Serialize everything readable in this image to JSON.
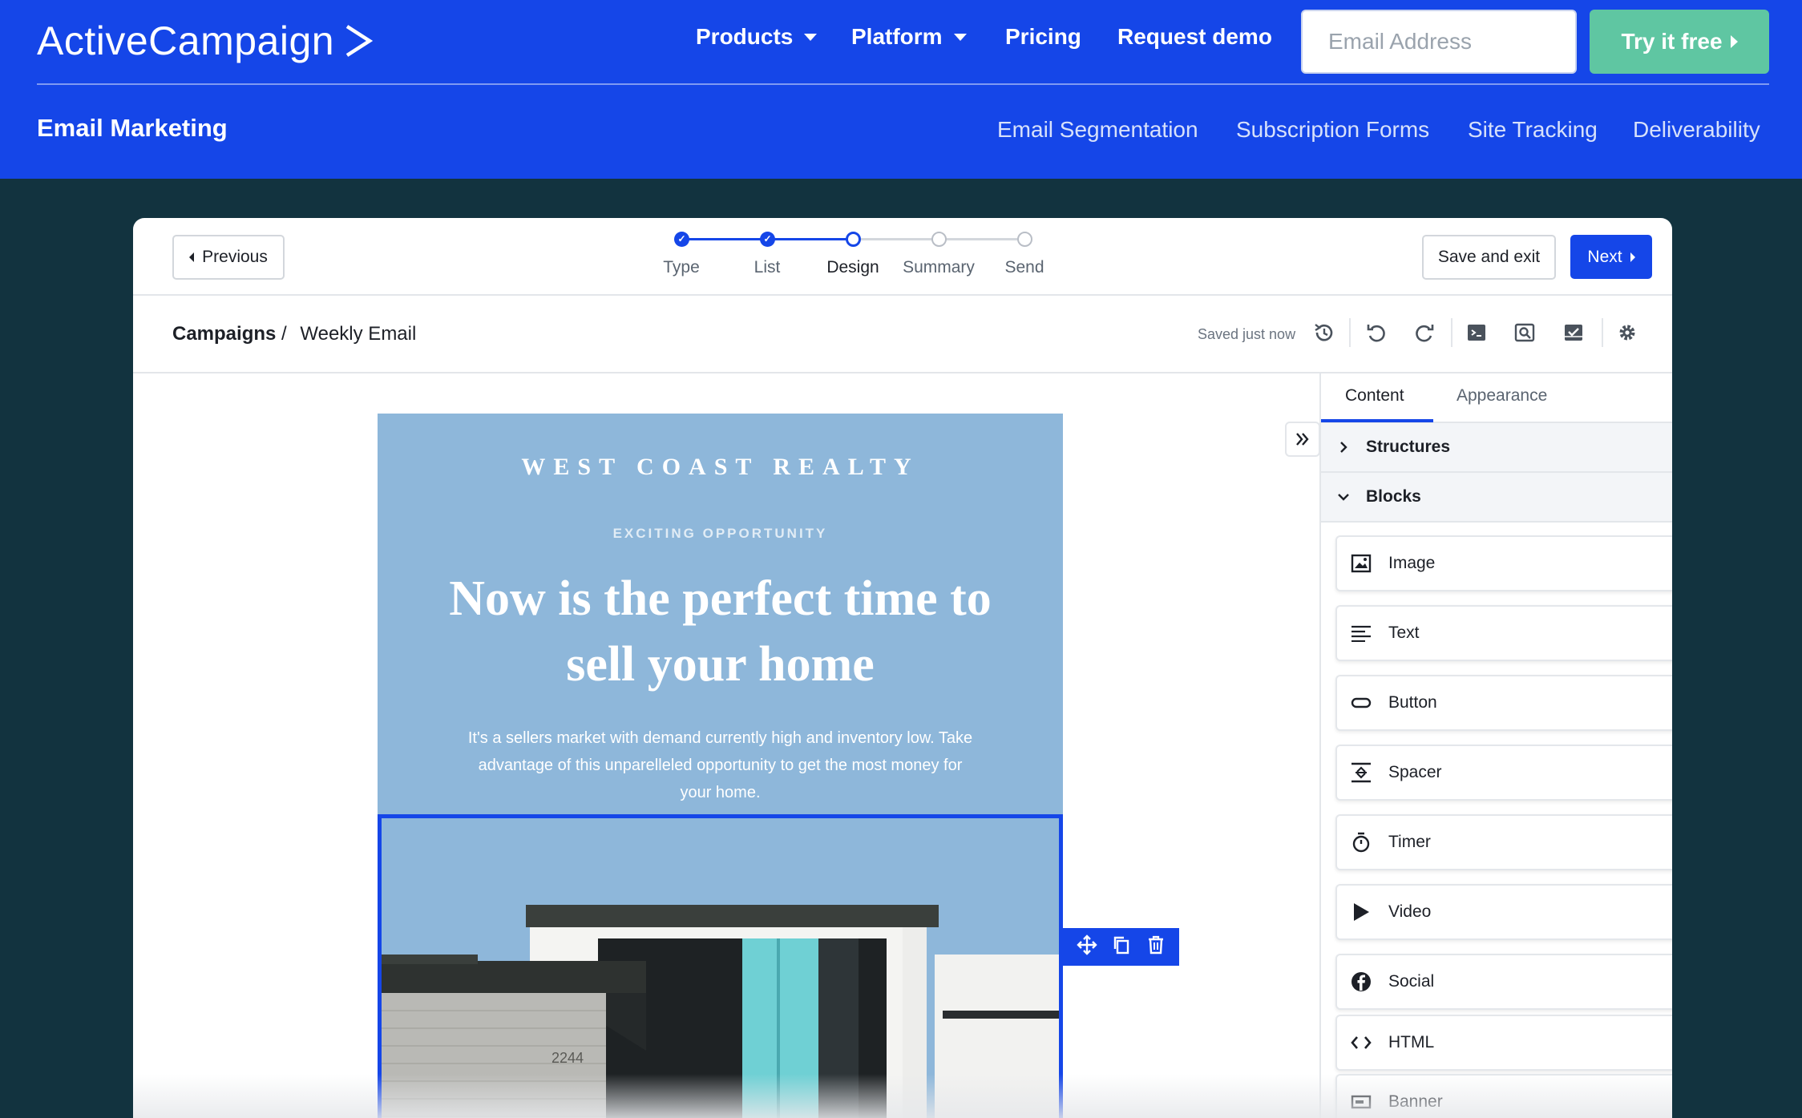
{
  "site": {
    "brand": "ActiveCampaign",
    "nav": [
      "Products",
      "Platform",
      "Pricing",
      "Request demo"
    ],
    "email_placeholder": "Email Address",
    "cta": "Try it free",
    "section_title": "Email Marketing",
    "subnav": [
      "Email Segmentation",
      "Subscription Forms",
      "Site Tracking",
      "Deliverability"
    ]
  },
  "editor": {
    "previous_label": "Previous",
    "steps": [
      {
        "label": "Type",
        "state": "done"
      },
      {
        "label": "List",
        "state": "done"
      },
      {
        "label": "Design",
        "state": "current"
      },
      {
        "label": "Summary",
        "state": "todo"
      },
      {
        "label": "Send",
        "state": "todo"
      }
    ],
    "save_exit_label": "Save and exit",
    "next_label": "Next",
    "breadcrumb_root": "Campaigns",
    "breadcrumb_sep": "/",
    "breadcrumb_current": "Weekly Email",
    "saved_status": "Saved just now",
    "toolbar_icons": [
      "history-icon",
      "undo-icon",
      "redo-icon",
      "code-icon",
      "preview-icon",
      "test-icon",
      "settings-icon"
    ]
  },
  "email": {
    "brand": "WEST COAST REALTY",
    "eyebrow": "EXCITING OPPORTUNITY",
    "headline": "Now is the perfect time to sell your home",
    "body": "It's a sellers market with demand currently high and inventory low. Take advantage of this unparelleled opportunity to get the most money for your home.",
    "house_number": "2244",
    "block_actions": [
      "move-icon",
      "duplicate-icon",
      "delete-icon"
    ]
  },
  "panel": {
    "tabs": [
      "Content",
      "Appearance"
    ],
    "active_tab": "Content",
    "structures_label": "Structures",
    "blocks_label": "Blocks",
    "blocks": [
      {
        "label": "Image",
        "icon": "image-icon"
      },
      {
        "label": "Text",
        "icon": "text-icon"
      },
      {
        "label": "Button",
        "icon": "button-icon"
      },
      {
        "label": "Spacer",
        "icon": "spacer-icon"
      },
      {
        "label": "Timer",
        "icon": "timer-icon"
      },
      {
        "label": "Video",
        "icon": "video-icon"
      },
      {
        "label": "Social",
        "icon": "social-icon"
      },
      {
        "label": "HTML",
        "icon": "html-icon"
      },
      {
        "label": "Banner",
        "icon": "banner-icon"
      }
    ]
  },
  "colors": {
    "brand_blue": "#1546e8",
    "cta_green": "#5fc6a2",
    "page_bg": "#12333f",
    "email_bg": "#8eb7da"
  }
}
